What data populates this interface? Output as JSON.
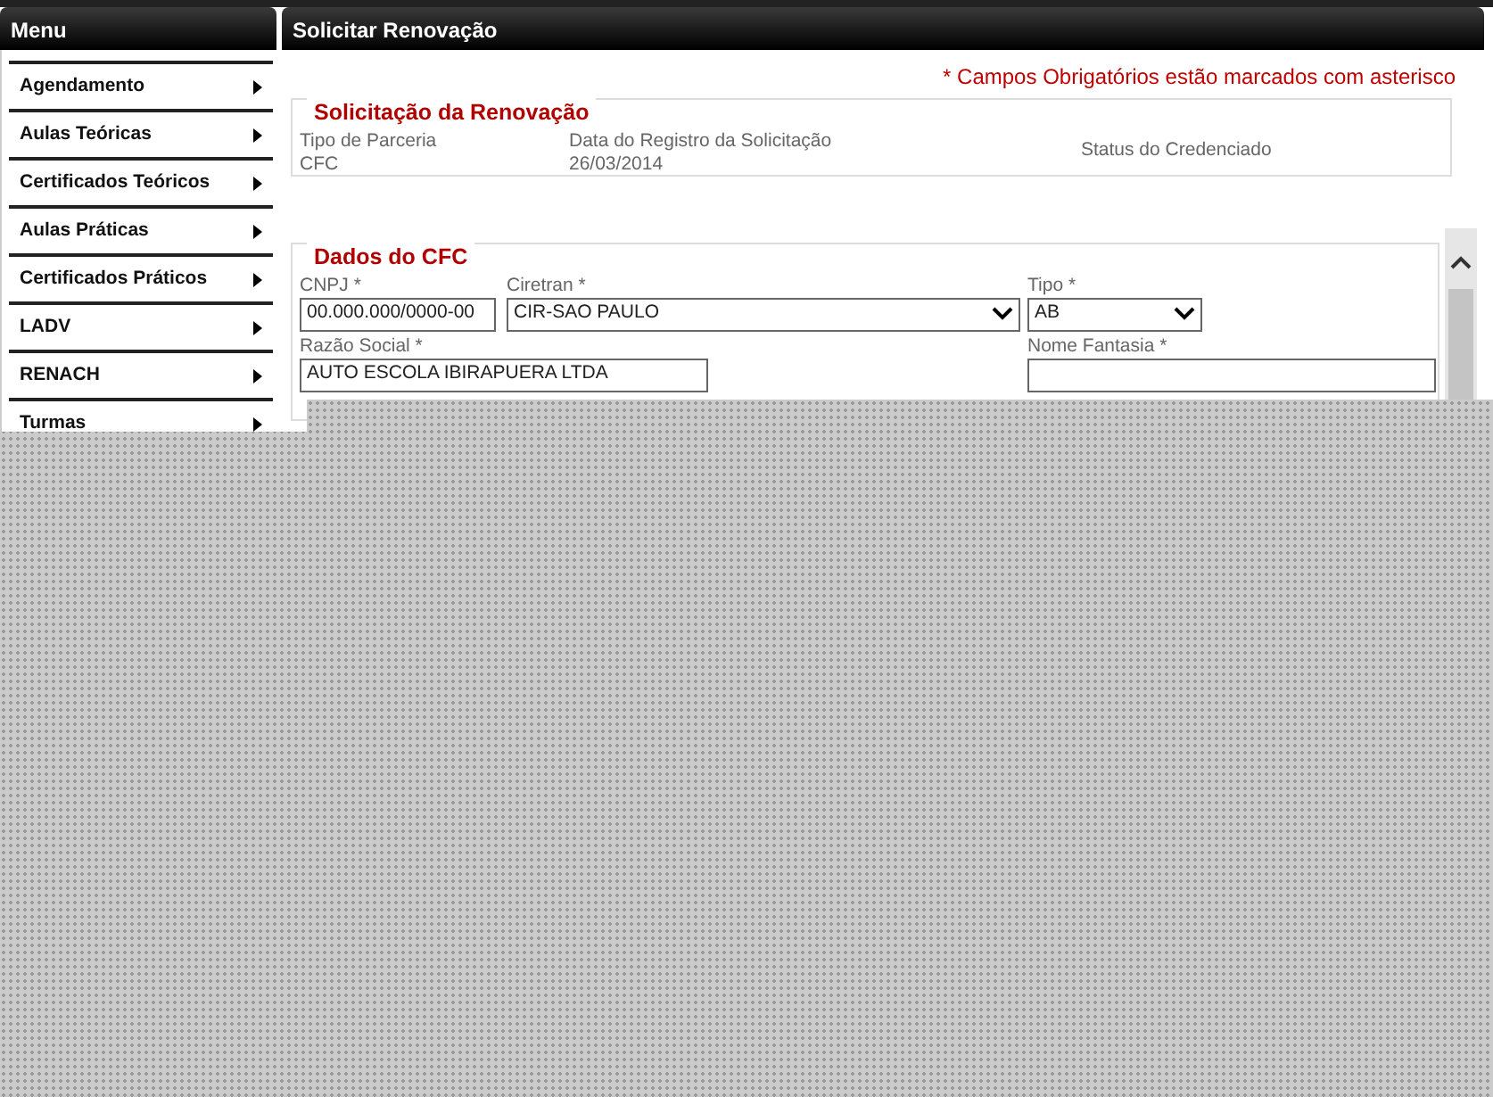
{
  "menu": {
    "title": "Menu",
    "items": [
      {
        "label": "Agendamento"
      },
      {
        "label": "Aulas Teóricas"
      },
      {
        "label": "Certificados Teóricos"
      },
      {
        "label": "Aulas Práticas"
      },
      {
        "label": "Certificados Práticos"
      },
      {
        "label": "LADV"
      },
      {
        "label": "RENACH"
      },
      {
        "label": "Turmas"
      }
    ]
  },
  "panel": {
    "title": "Solicitar Renovação",
    "required_note": "* Campos Obrigatórios estão marcados com asterisco",
    "request": {
      "legend": "Solicitação da Renovação",
      "fields": [
        {
          "label": "Tipo de Parceria",
          "value": "CFC"
        },
        {
          "label": "Data do Registro da Solicitação",
          "value": "26/03/2014"
        },
        {
          "label": "Status do Credenciado"
        }
      ]
    },
    "cfc": {
      "legend": "Dados do CFC",
      "fields": [
        {
          "kind": "input",
          "label": "CNPJ *",
          "value": "00.000.000/0000-00"
        },
        {
          "kind": "select",
          "label": "Ciretran *",
          "value": "CIR-SAO PAULO"
        },
        {
          "kind": "select",
          "label": "Tipo *",
          "value": "AB"
        },
        {
          "kind": "input",
          "label": "Razão Social *",
          "value": "AUTO ESCOLA IBIRAPUERA LTDA"
        },
        {
          "kind": "input",
          "label": "Nome Fantasia *"
        }
      ]
    }
  }
}
